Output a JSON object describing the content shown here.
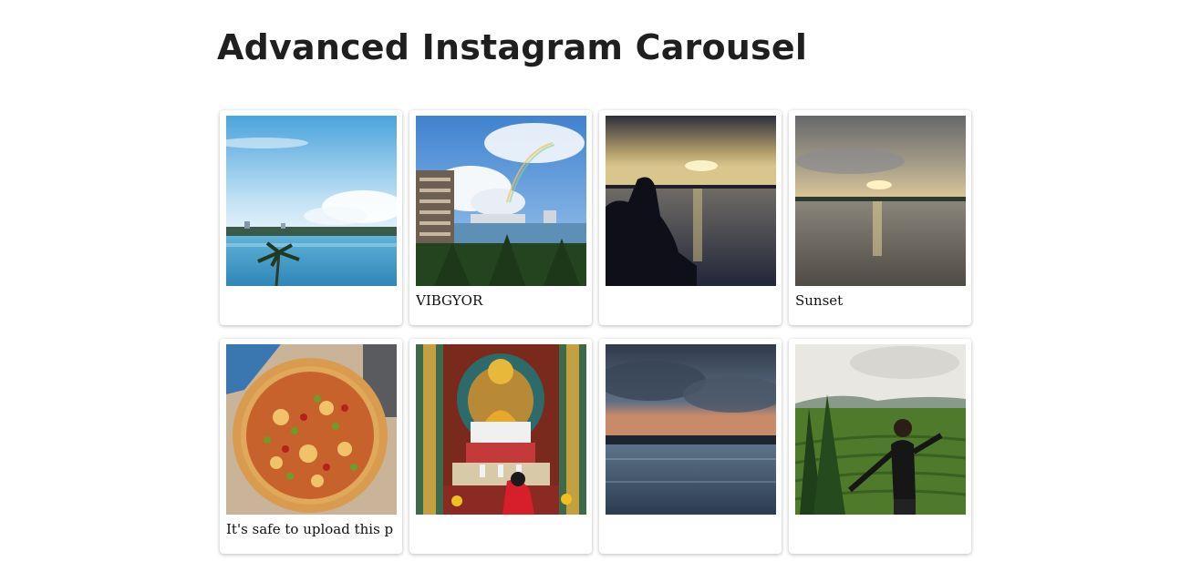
{
  "page": {
    "title": "Advanced Instagram Carousel"
  },
  "posts": [
    {
      "caption": "",
      "image": "lake-skyline-photo"
    },
    {
      "caption": "VIBGYOR",
      "image": "rainbow-building-photo"
    },
    {
      "caption": "",
      "image": "silhouette-sunset-photo"
    },
    {
      "caption": "Sunset",
      "image": "sunset-river-photo"
    },
    {
      "caption": "It's safe to upload this p",
      "image": "pizza-photo"
    },
    {
      "caption": "",
      "image": "buddha-temple-photo"
    },
    {
      "caption": "",
      "image": "cloudy-lake-photo"
    },
    {
      "caption": "",
      "image": "tea-garden-man-photo"
    }
  ]
}
